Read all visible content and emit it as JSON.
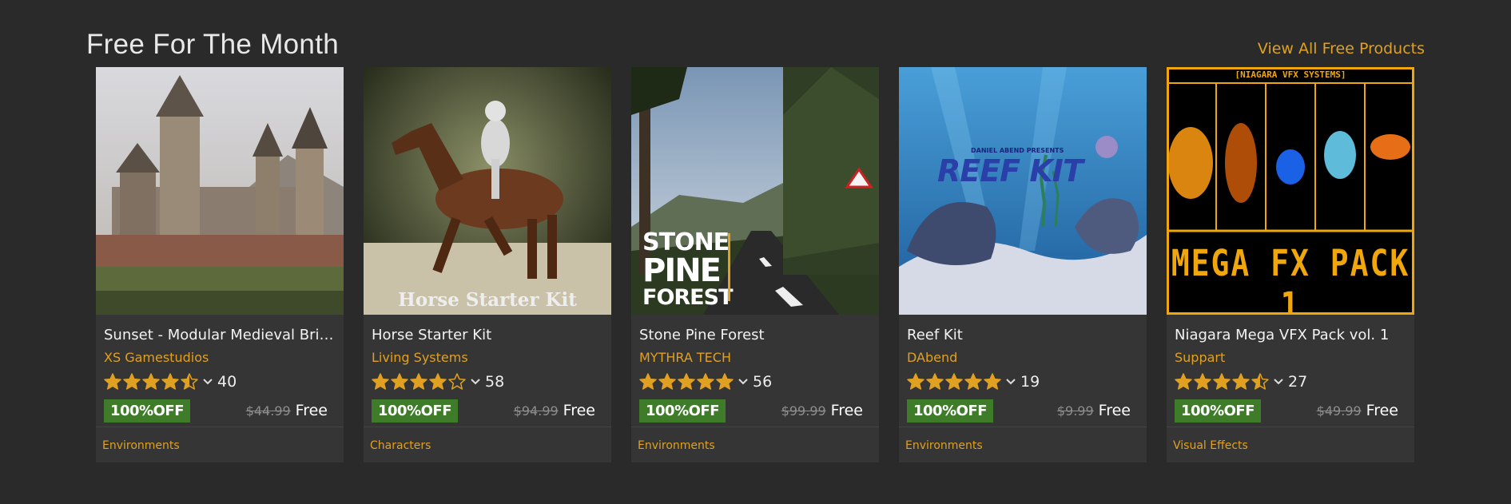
{
  "section": {
    "title": "Free For The Month",
    "view_all": "View All Free Products"
  },
  "colors": {
    "accent": "#e0a021",
    "badge": "#3f7c2a",
    "card_bg": "#353535",
    "page_bg": "#2a2a2a"
  },
  "products": [
    {
      "title": "Sunset - Modular Medieval Brick ...",
      "seller": "XS Gamestudios",
      "rating": 4.5,
      "rating_count": "40",
      "discount": "100%OFF",
      "original_price": "$44.99",
      "price": "Free",
      "category": "Environments"
    },
    {
      "title": "Horse Starter Kit",
      "seller": "Living Systems",
      "rating": 4.0,
      "rating_count": "58",
      "discount": "100%OFF",
      "original_price": "$94.99",
      "price": "Free",
      "category": "Characters",
      "image_text": "Horse Starter Kit"
    },
    {
      "title": "Stone Pine Forest",
      "seller": "MYTHRA TECH",
      "rating": 5.0,
      "rating_count": "56",
      "discount": "100%OFF",
      "original_price": "$99.99",
      "price": "Free",
      "category": "Environments",
      "image_text_1": "STONE",
      "image_text_2": "PINE",
      "image_text_3": "FOREST"
    },
    {
      "title": "Reef Kit",
      "seller": "DAbend",
      "rating": 5.0,
      "rating_count": "19",
      "discount": "100%OFF",
      "original_price": "$9.99",
      "price": "Free",
      "category": "Environments",
      "image_text_small": "DANIEL ABEND PRESENTS",
      "image_text": "REEF KIT"
    },
    {
      "title": "Niagara Mega VFX Pack vol. 1",
      "seller": "Suppart",
      "rating": 4.5,
      "rating_count": "27",
      "discount": "100%OFF",
      "original_price": "$49.99",
      "price": "Free",
      "category": "Visual Effects",
      "image_text_top": "[NIAGARA VFX SYSTEMS]",
      "image_text": "MEGA FX PACK 1"
    }
  ]
}
